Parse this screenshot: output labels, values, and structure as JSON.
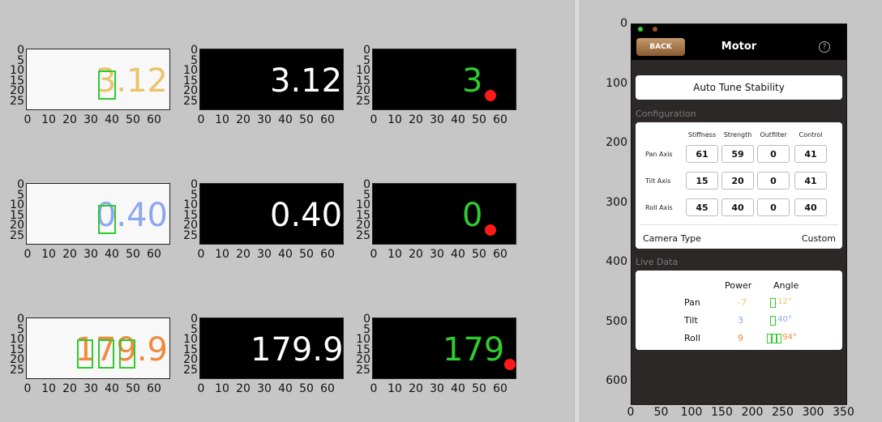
{
  "left_plots": {
    "y_ticks": [
      "0",
      "5",
      "10",
      "15",
      "20",
      "25"
    ],
    "x_ticks": [
      "0",
      "10",
      "20",
      "30",
      "40",
      "50",
      "60"
    ],
    "rows": [
      {
        "white_text": "3.12",
        "white_color": "#e9c46a",
        "black_text": "3.12",
        "detected_text": "3"
      },
      {
        "white_text": "0.40",
        "white_color": "#8ea6f2",
        "black_text": "0.40",
        "detected_text": "0"
      },
      {
        "white_text": "179.9",
        "white_color": "#f08a3c",
        "black_text": "179.9",
        "detected_text": "179"
      }
    ],
    "detected_color": "#2ecc2e",
    "dot_color": "#ff1a1a"
  },
  "phone": {
    "back_label": "BACK",
    "title": "Motor",
    "help_icon": "?",
    "auto_tune_label": "Auto Tune Stability",
    "configuration_label": "Configuration",
    "columns": [
      "Stiffness",
      "Strength",
      "Outfilter",
      "Control"
    ],
    "axes": [
      {
        "label": "Pan Axis",
        "values": [
          "61",
          "59",
          "0",
          "41"
        ]
      },
      {
        "label": "Tilt Axis",
        "values": [
          "15",
          "20",
          "0",
          "41"
        ]
      },
      {
        "label": "Roll Axis",
        "values": [
          "45",
          "40",
          "0",
          "40"
        ]
      }
    ],
    "camera_type_label": "Camera Type",
    "camera_type_value": "Custom",
    "live_data_label": "Live Data",
    "live_headers": [
      "Power",
      "Angle"
    ],
    "live_rows": [
      {
        "label": "Pan",
        "power": "-7",
        "angle": ".12°",
        "color": "#e9c46a"
      },
      {
        "label": "Tilt",
        "power": "3",
        "angle": ".40°",
        "color": "#8ea6f2"
      },
      {
        "label": "Roll",
        "power": "9",
        "angle": ".94°",
        "color": "#f08a3c"
      }
    ]
  },
  "right_axes": {
    "y_ticks": [
      "0",
      "100",
      "200",
      "300",
      "400",
      "500",
      "600"
    ],
    "x_ticks": [
      "0",
      "50",
      "100",
      "150",
      "200",
      "250",
      "300",
      "350"
    ]
  }
}
